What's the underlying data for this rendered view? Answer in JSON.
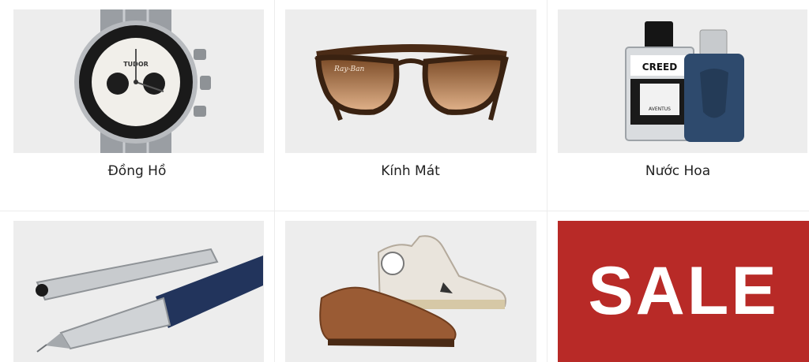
{
  "categories": [
    {
      "label": "Đồng Hồ",
      "icon": "watch-icon"
    },
    {
      "label": "Kính Mát",
      "icon": "sunglasses-icon"
    },
    {
      "label": "Nước Hoa",
      "icon": "perfume-icon"
    }
  ],
  "bottom_tiles": [
    {
      "icon": "pen-icon"
    },
    {
      "icon": "shoes-icon"
    }
  ],
  "sale_banner": {
    "text": "SALE",
    "color": "#b82a27"
  },
  "watch": {
    "brand": "TUDOR"
  },
  "sunglasses": {
    "brand": "Ray-Ban"
  },
  "perfume": {
    "brand": "CREED",
    "name": "AVENTUS"
  }
}
